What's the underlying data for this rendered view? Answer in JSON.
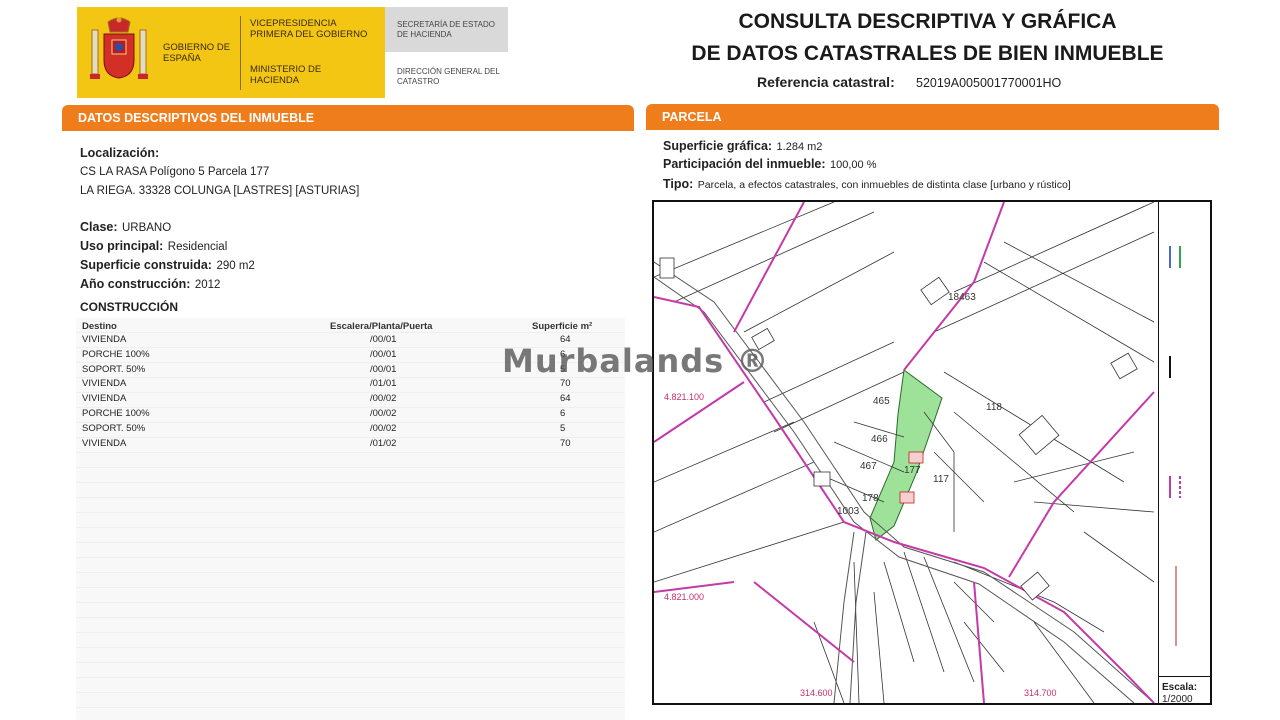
{
  "header": {
    "gov_label": "GOBIERNO DE ESPAÑA",
    "vice_label": "VICEPRESIDENCIA PRIMERA DEL GOBIERNO",
    "ministry_label": "MINISTERIO DE HACIENDA",
    "secretary_label": "SECRETARÍA DE ESTADO DE HACIENDA",
    "direction_label": "DIRECCIÓN GENERAL DEL CATASTRO",
    "title_line1": "CONSULTA DESCRIPTIVA Y GRÁFICA",
    "title_line2": "DE DATOS CATASTRALES DE BIEN INMUEBLE",
    "ref_label": "Referencia catastral:",
    "ref_value": "52019A005001770001HO"
  },
  "descriptive": {
    "section_title": "DATOS DESCRIPTIVOS DEL INMUEBLE",
    "location_label": "Localización:",
    "location_line1": "CS LA RASA  Polígono 5 Parcela 177",
    "location_line2": "LA RIEGA. 33328 COLUNGA [LASTRES] [ASTURIAS]",
    "clase_label": "Clase:",
    "clase_value": "URBANO",
    "uso_label": "Uso principal:",
    "uso_value": "Residencial",
    "superficie_label": "Superficie construida:",
    "superficie_value": "290 m2",
    "anio_label": "Año construcción:",
    "anio_value": "2012",
    "construccion_title": "CONSTRUCCIÓN",
    "table": {
      "headers": [
        "Destino",
        "Escalera/Planta/Puerta",
        "Superficie m²"
      ],
      "rows": [
        [
          "VIVIENDA",
          "/00/01",
          "64"
        ],
        [
          "PORCHE 100%",
          "/00/01",
          "6"
        ],
        [
          "SOPORT. 50%",
          "/00/01",
          "5"
        ],
        [
          "VIVIENDA",
          "/01/01",
          "70"
        ],
        [
          "VIVIENDA",
          "/00/02",
          "64"
        ],
        [
          "PORCHE 100%",
          "/00/02",
          "6"
        ],
        [
          "SOPORT. 50%",
          "/00/02",
          "5"
        ],
        [
          "VIVIENDA",
          "/01/02",
          "70"
        ]
      ]
    }
  },
  "parcela": {
    "section_title": "PARCELA",
    "sup_label": "Superficie gráfica:",
    "sup_value": "1.284 m2",
    "part_label": "Participación del inmueble:",
    "part_value": "100,00 %",
    "tipo_label": "Tipo:",
    "tipo_value": "Parcela, a efectos catastrales, con inmuebles de distinta clase [urbano y rústico]"
  },
  "map": {
    "parcel_numbers": [
      "465",
      "466",
      "467",
      "177",
      "178",
      "117",
      "118",
      "18463",
      "1003"
    ],
    "coord_y_top": "4.821.100",
    "coord_y_bottom": "4.821.000",
    "coord_x_left": "314.600",
    "coord_x_right": "314.700",
    "scale_label": "Escala:",
    "scale_value": "1/2000",
    "highlight_color": "#9ee29a",
    "boundary_color": "#c43aa8"
  },
  "watermark": "Murbalands ®"
}
